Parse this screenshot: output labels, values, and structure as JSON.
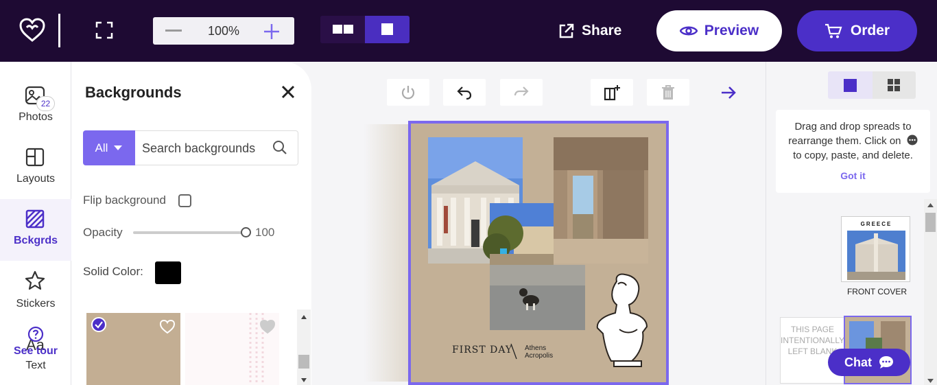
{
  "topbar": {
    "zoom_value": "100%",
    "share_label": "Share",
    "preview_label": "Preview",
    "order_label": "Order",
    "colors": {
      "bar": "#1e0a33",
      "accent": "#4b2fc8"
    }
  },
  "leftnav": {
    "items": [
      {
        "label": "Photos",
        "icon": "photos-icon",
        "badge": "22"
      },
      {
        "label": "Layouts",
        "icon": "layouts-icon"
      },
      {
        "label": "Bckgrds",
        "icon": "backgrounds-icon",
        "active": true
      },
      {
        "label": "Stickers",
        "icon": "star-icon"
      },
      {
        "label": "Text",
        "icon": "text-icon"
      }
    ],
    "see_tour": "See tour"
  },
  "panel": {
    "title": "Backgrounds",
    "filter_label": "All",
    "search_placeholder": "Search backgrounds",
    "flip_label": "Flip background",
    "flip_checked": false,
    "opacity_label": "Opacity",
    "opacity_value": "100",
    "solid_color_label": "Solid Color:",
    "solid_color": "#000000"
  },
  "canvas": {
    "caption_title": "FIRST DAY",
    "caption_place_line1": "Athens",
    "caption_place_line2": "Acropolis"
  },
  "rightpanel": {
    "tip_line1": "Drag and drop spreads to",
    "tip_line2": "rearrange them. Click on",
    "tip_line3": "to copy, paste, and delete.",
    "got_it": "Got it",
    "cover_title": "GREECE",
    "cover_label": "FRONT COVER",
    "blank_line1": "THIS PAGE",
    "blank_line2": "INTENTIONALLY",
    "blank_line3": "LEFT BLANK",
    "chat_label": "Chat"
  }
}
